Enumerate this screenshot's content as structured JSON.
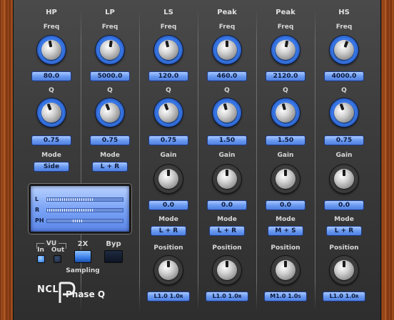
{
  "plugin": {
    "logo_ncl": "NCL",
    "logo_phase": "Phase Q",
    "logo_p": "P"
  },
  "bands": [
    {
      "title": "HP",
      "freq_label": "Freq",
      "freq": "80.0",
      "q_label": "Q",
      "q": "0.75",
      "mode_label": "Mode",
      "mode": "Side"
    },
    {
      "title": "LP",
      "freq_label": "Freq",
      "freq": "5000.0",
      "q_label": "Q",
      "q": "0.75",
      "mode_label": "Mode",
      "mode": "L + R"
    },
    {
      "title": "LS",
      "freq_label": "Freq",
      "freq": "120.0",
      "q_label": "Q",
      "q": "0.75",
      "gain_label": "Gain",
      "gain": "0.0",
      "mode_label": "Mode",
      "mode": "L + R",
      "pos_label": "Position",
      "pos_a": "L1.0",
      "pos_a_tag": "",
      "pos_b": "1.0",
      "pos_b_tag": "R"
    },
    {
      "title": "Peak",
      "freq_label": "Freq",
      "freq": "460.0",
      "q_label": "Q",
      "q": "1.50",
      "gain_label": "Gain",
      "gain": "0.0",
      "mode_label": "Mode",
      "mode": "L + R",
      "pos_label": "Position",
      "pos_a": "L1.0",
      "pos_a_tag": "",
      "pos_b": "1.0",
      "pos_b_tag": "R"
    },
    {
      "title": "Peak",
      "freq_label": "Freq",
      "freq": "2120.0",
      "q_label": "Q",
      "q": "1.50",
      "gain_label": "Gain",
      "gain": "0.0",
      "mode_label": "Mode",
      "mode": "M + S",
      "pos_label": "Position",
      "pos_a": "M1.0",
      "pos_a_tag": "",
      "pos_b": "1.0",
      "pos_b_tag": "S"
    },
    {
      "title": "HS",
      "freq_label": "Freq",
      "freq": "4000.0",
      "q_label": "Q",
      "q": "0.75",
      "gain_label": "Gain",
      "gain": "0.0",
      "mode_label": "Mode",
      "mode": "L + R",
      "pos_label": "Position",
      "pos_a": "L1.0",
      "pos_a_tag": "",
      "pos_b": "1.0",
      "pos_b_tag": "R"
    }
  ],
  "vu": {
    "rows": [
      {
        "label": "L",
        "level": 0.6
      },
      {
        "label": "R",
        "level": 0.6
      },
      {
        "label": "PH",
        "level": 0.12
      }
    ],
    "group_label": "VU",
    "in_label": "In",
    "out_label": "Out",
    "in_on": true,
    "out_on": false
  },
  "sampling": {
    "x2_label": "2X",
    "sampling_label": "Sampling",
    "x2_on": true
  },
  "bypass": {
    "label": "Byp",
    "on": false
  },
  "colors": {
    "accent": "#3a7cf0",
    "panel": "#3c3c3c",
    "field": "#6b9af0"
  }
}
